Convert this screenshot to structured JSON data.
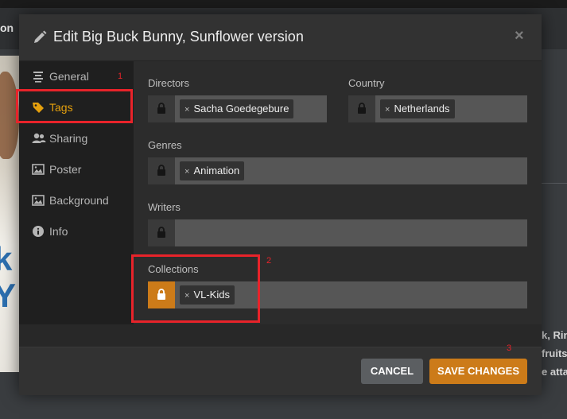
{
  "background": {
    "nav_text": "on",
    "poster_letters": [
      "k",
      "Y"
    ],
    "right_lines": [
      "k, Rin",
      "fruits",
      "e atta"
    ],
    "bottom_text": "·· ·· ·"
  },
  "modal": {
    "title": "Edit Big Buck Bunny, Sunflower version",
    "close": "×"
  },
  "sidebar": {
    "items": [
      {
        "label": "General",
        "icon": "menu-lines-icon"
      },
      {
        "label": "Tags",
        "icon": "tag-icon",
        "active": true
      },
      {
        "label": "Sharing",
        "icon": "users-icon"
      },
      {
        "label": "Poster",
        "icon": "image-icon"
      },
      {
        "label": "Background",
        "icon": "image-icon"
      },
      {
        "label": "Info",
        "icon": "info-icon"
      }
    ]
  },
  "fields": {
    "directors": {
      "label": "Directors",
      "tags": [
        "Sacha Goedegebure"
      ],
      "locked": false
    },
    "country": {
      "label": "Country",
      "tags": [
        "Netherlands"
      ],
      "locked": false
    },
    "genres": {
      "label": "Genres",
      "tags": [
        "Animation"
      ],
      "locked": false
    },
    "writers": {
      "label": "Writers",
      "tags": [],
      "locked": false
    },
    "collections": {
      "label": "Collections",
      "tags": [
        "VL-Kids"
      ],
      "locked": true
    }
  },
  "tag_remove_symbol": "×",
  "footer": {
    "cancel_label": "CANCEL",
    "save_label": "SAVE CHANGES"
  },
  "annotations": {
    "one": "1",
    "two": "2",
    "three": "3"
  },
  "colors": {
    "accent": "#cc7b19",
    "active_text": "#e5a00d",
    "annotation": "#e8232a"
  }
}
